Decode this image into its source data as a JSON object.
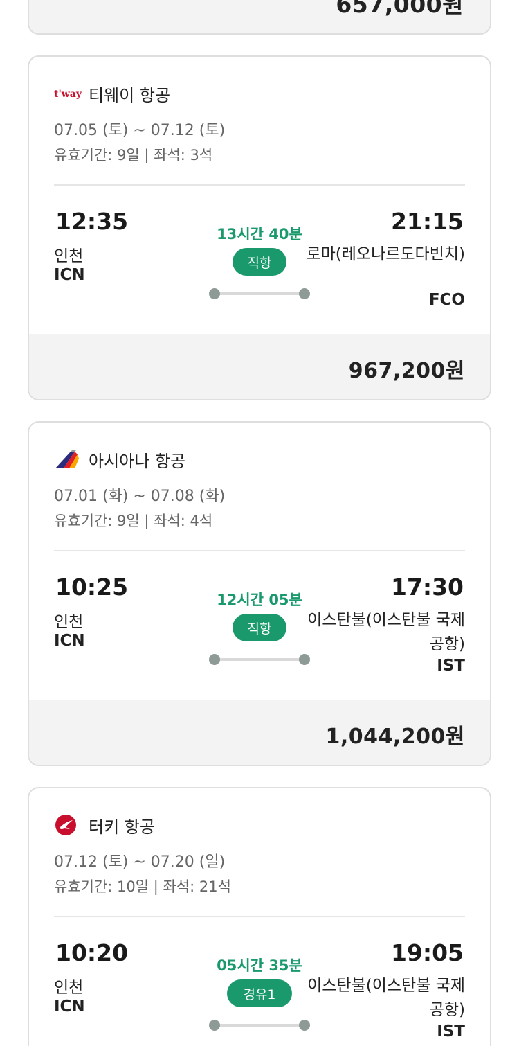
{
  "colors": {
    "accent_green": "#1a9a6c",
    "price_bar_bg": "#f3f3f3",
    "border": "#dedede"
  },
  "previous_card": {
    "price": "657,000원"
  },
  "flights": [
    {
      "airline": "티웨이 항공",
      "logo_icon": "tway-logo-icon",
      "logo_text": "t'way",
      "dates": "07.05 (토) ~ 07.12 (토)",
      "meta": "유효기간: 9일 | 좌석: 3석",
      "departure": {
        "time": "12:35",
        "city": "인천",
        "code": "ICN"
      },
      "duration": "13시간 40분",
      "stops": "직항",
      "arrival": {
        "time": "21:15",
        "city": "로마(레오나르도다빈치)",
        "code": "FCO"
      },
      "price": "967,200원"
    },
    {
      "airline": "아시아나 항공",
      "logo_icon": "asiana-logo-icon",
      "dates": "07.01 (화) ~ 07.08 (화)",
      "meta": "유효기간: 9일 | 좌석: 4석",
      "departure": {
        "time": "10:25",
        "city": "인천",
        "code": "ICN"
      },
      "duration": "12시간 05분",
      "stops": "직항",
      "arrival": {
        "time": "17:30",
        "city": "이스탄불(이스탄불 국제공항)",
        "code": "IST"
      },
      "price": "1,044,200원"
    },
    {
      "airline": "터키 항공",
      "logo_icon": "turkish-airlines-logo-icon",
      "dates": "07.12 (토) ~ 07.20 (일)",
      "meta": "유효기간: 10일 | 좌석: 21석",
      "departure": {
        "time": "10:20",
        "city": "인천",
        "code": "ICN"
      },
      "duration": "05시간 35분",
      "stops": "경유1",
      "arrival": {
        "time": "19:05",
        "city": "이스탄불(이스탄불 국제공항)",
        "code": "IST"
      }
    }
  ]
}
